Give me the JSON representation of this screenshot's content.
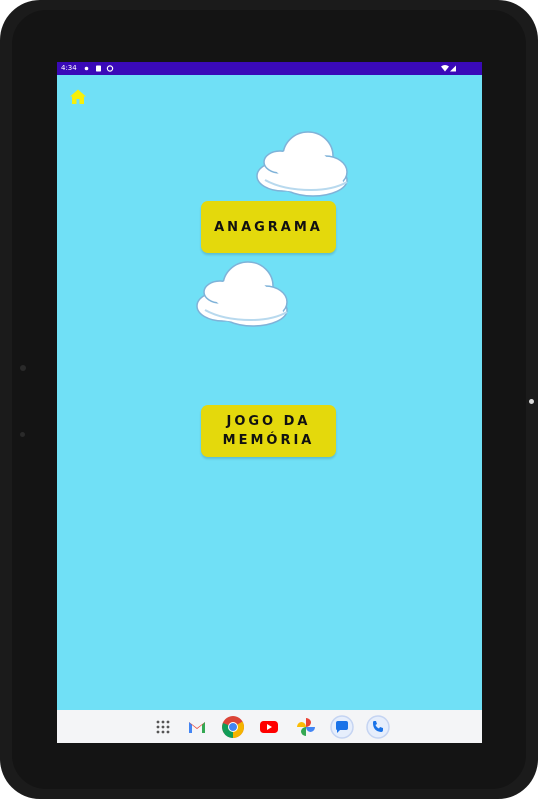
{
  "status_bar": {
    "time": "4:34",
    "left_icons": [
      "settings-icon",
      "sd-card-icon",
      "sync-icon"
    ],
    "right_icons": [
      "wifi-icon",
      "signal-icon"
    ]
  },
  "toolbar": {
    "home_icon": "home-icon",
    "home_color": "#f7f00a"
  },
  "menu": {
    "buttons": [
      {
        "label": "ANAGRAMA"
      },
      {
        "label_line1": "JOGO DA",
        "label_line2": "MEMÓRIA"
      }
    ],
    "button_color": "#e4d90c"
  },
  "colors": {
    "background": "#70e0f6",
    "status_bar": "#3a0ab8"
  },
  "dock": {
    "apps": [
      "apps-grid-icon",
      "gmail-icon",
      "chrome-icon",
      "youtube-icon",
      "photos-icon",
      "messages-icon",
      "phone-icon"
    ]
  }
}
